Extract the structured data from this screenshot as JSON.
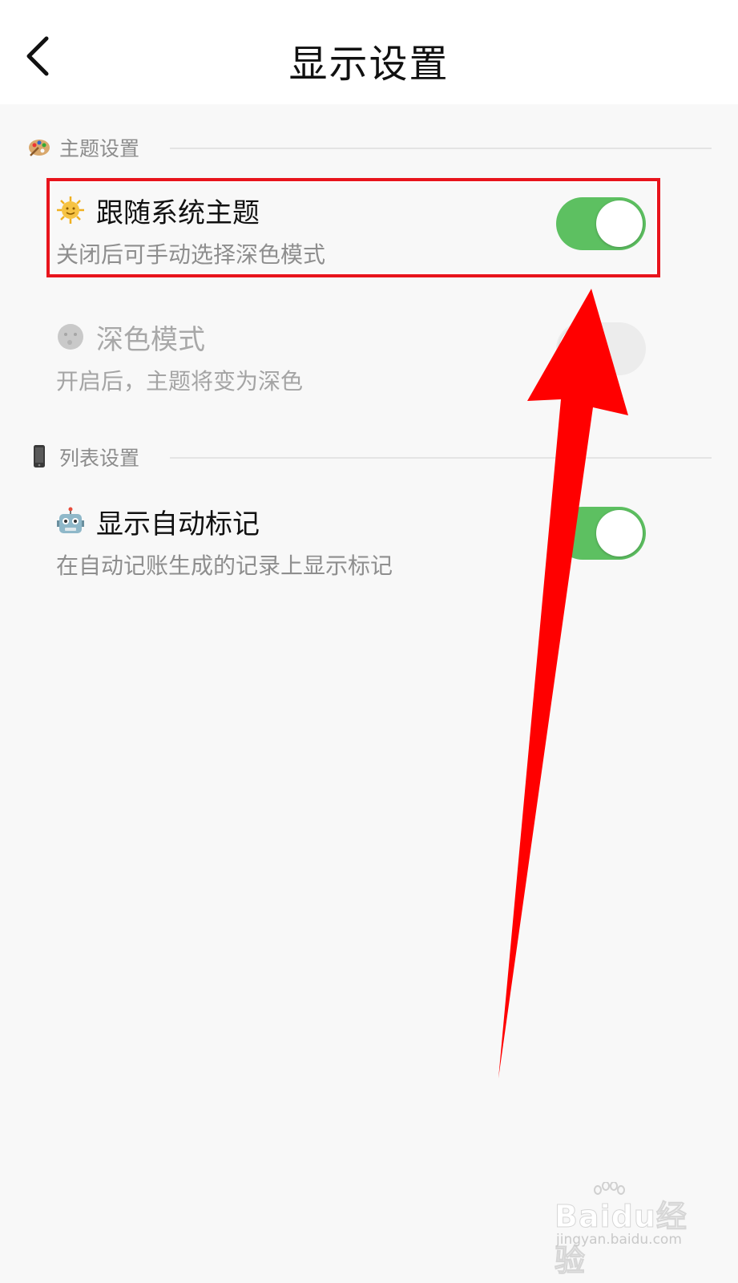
{
  "header": {
    "title": "显示设置",
    "back_icon": "chevron-left-icon"
  },
  "sections": [
    {
      "title": "主题设置",
      "icon": "palette-icon",
      "items": [
        {
          "icon": "sun-icon",
          "title": "跟随系统主题",
          "description": "关闭后可手动选择深色模式",
          "toggle_on": true,
          "enabled": true
        },
        {
          "icon": "moon-icon",
          "title": "深色模式",
          "description": "开启后，主题将变为深色",
          "toggle_on": false,
          "enabled": false
        }
      ]
    },
    {
      "title": "列表设置",
      "icon": "mobile-phone-icon",
      "items": [
        {
          "icon": "robot-icon",
          "title": "显示自动标记",
          "description": "在自动记账生成的记录上显示标记",
          "toggle_on": true,
          "enabled": true
        }
      ]
    }
  ],
  "colors": {
    "toggle_on": "#5dc061",
    "highlight": "#e8141c",
    "arrow": "#ff0000"
  },
  "watermark": {
    "main": "Baidu经验",
    "sub": "jingyan.baidu.com"
  }
}
